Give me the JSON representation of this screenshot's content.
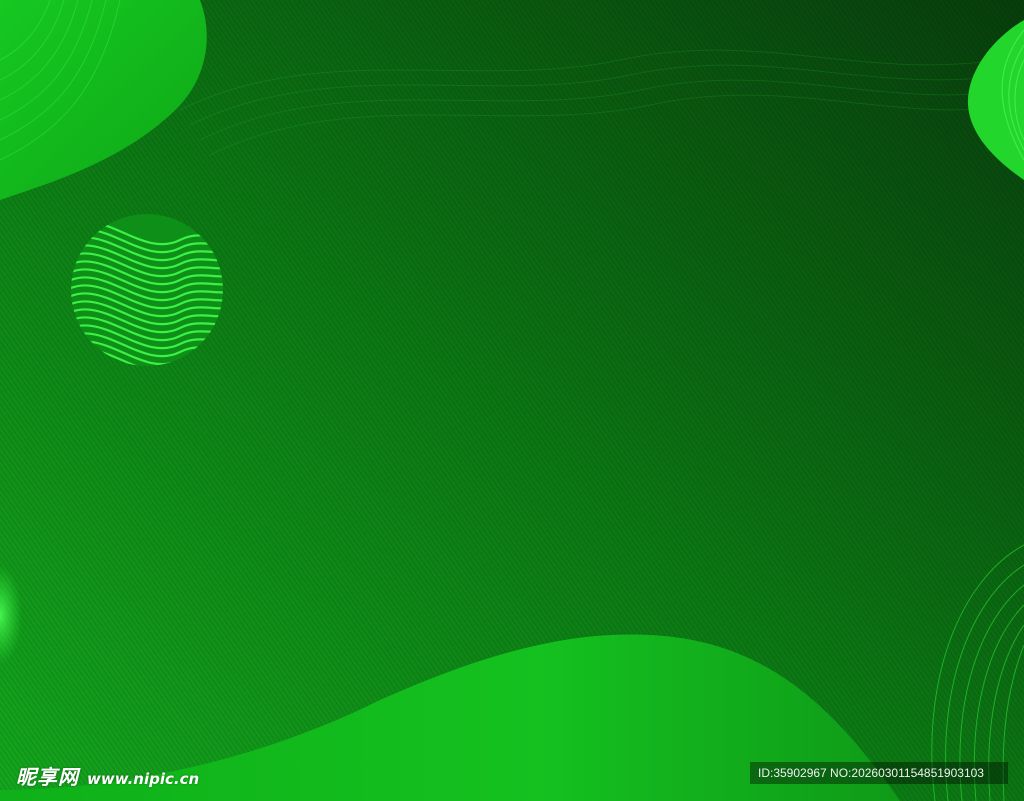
{
  "watermark": {
    "brand": "昵享网",
    "site": "www.nipic.cn",
    "id_text": "ID:35902967 NO:20260301154851903103"
  },
  "colors": {
    "background_dark": "#0a3f0e",
    "background_light": "#0f8a18",
    "blob": "#13c41e",
    "accent": "#2ee83a"
  }
}
